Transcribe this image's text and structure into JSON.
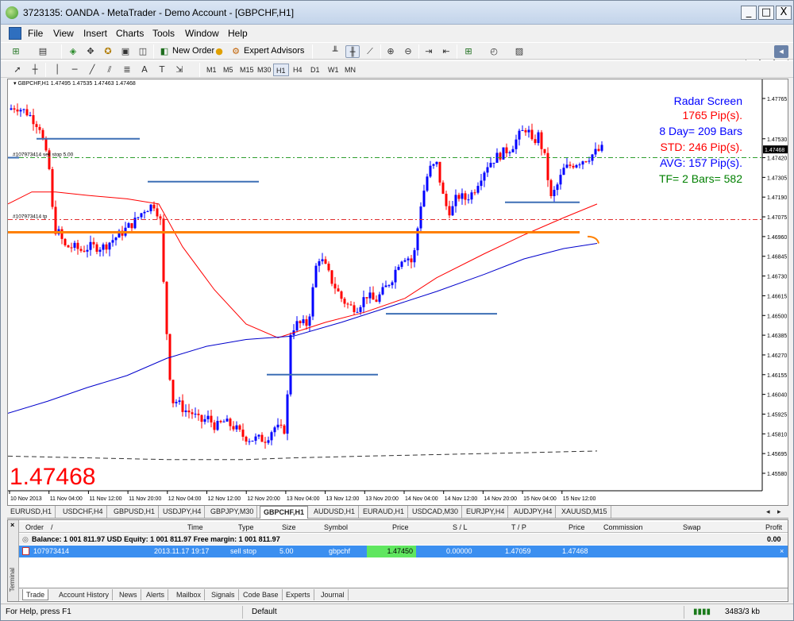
{
  "window": {
    "title": "3723135: OANDA - MetaTrader - Demo Account - [GBPCHF,H1]",
    "controls": [
      "_",
      "□",
      "X"
    ],
    "mdi_controls": [
      "_",
      "ᴩ",
      "X"
    ]
  },
  "menu": [
    "File",
    "View",
    "Insert",
    "Charts",
    "Tools",
    "Window",
    "Help"
  ],
  "toolbar": {
    "new_order": "New Order",
    "expert_advisors": "Expert Advisors",
    "timeframes": [
      "M1",
      "M5",
      "M15",
      "M30",
      "H1",
      "H4",
      "D1",
      "W1",
      "MN"
    ],
    "active_timeframe": "H1"
  },
  "chart": {
    "symbol_info": "GBPCHF,H1  1.47495 1.47535 1.47463 1.47468",
    "big_price": "1.47468",
    "order_label_1": "#107973414 sell stop 5.00",
    "order_label_2": "#107973414 tp",
    "current_price_tag": "1.47468",
    "radar": {
      "title": "Radar Screen",
      "pips": "1765 Pip(s).",
      "days": "8 Day= 209 Bars",
      "std": "STD: 246 Pip(s).",
      "avg": "AVG: 157 Pip(s).",
      "tf": "TF= 2 Bars= 582"
    },
    "colors": {
      "bull": "#0000ff",
      "bear": "#ff0000",
      "ma_fast": "#ff0000",
      "ma_slow": "#0000cc",
      "level": "#ff8000",
      "hlines": "#3d6fb5",
      "radar_title": "#0000ff",
      "radar_red": "#ff0000",
      "radar_green": "#008000"
    }
  },
  "chart_data": {
    "type": "candlestick",
    "y_ticks": [
      "1.47765",
      "1.47530",
      "1.47420",
      "1.47305",
      "1.47190",
      "1.47075",
      "1.46960",
      "1.46845",
      "1.46730",
      "1.46615",
      "1.46500",
      "1.46385",
      "1.46270",
      "1.46155",
      "1.46040",
      "1.45925",
      "1.45810",
      "1.45695",
      "1.45580"
    ],
    "x_ticks": [
      "10 Nov 2013",
      "11 Nov 04:00",
      "11 Nov 12:00",
      "11 Nov 20:00",
      "12 Nov 04:00",
      "12 Nov 12:00",
      "12 Nov 20:00",
      "13 Nov 04:00",
      "13 Nov 12:00",
      "13 Nov 20:00",
      "14 Nov 04:00",
      "14 Nov 12:00",
      "14 Nov 20:00",
      "15 Nov 04:00",
      "15 Nov 12:00"
    ],
    "ylim": [
      1.4556,
      1.4785
    ]
  },
  "symbol_tabs": [
    "EURUSD,H1",
    "USDCHF,H4",
    "GBPUSD,H1",
    "USDJPY,H4",
    "GBPJPY,M30",
    "GBPCHF,H1",
    "AUDUSD,H1",
    "EURAUD,H1",
    "USDCAD,M30",
    "EURJPY,H4",
    "AUDJPY,H4",
    "XAUUSD,M15"
  ],
  "active_symbol_tab": "GBPCHF,H1",
  "terminal": {
    "side_label": "Terminal",
    "columns": [
      "Order",
      "Time",
      "Type",
      "Size",
      "Symbol",
      "Price",
      "S / L",
      "T / P",
      "Price",
      "Commission",
      "Swap",
      "Profit"
    ],
    "balance_text": "Balance: 1 001 811.97 USD  Equity: 1 001 811.97  Free margin: 1 001 811.97",
    "balance_profit": "0.00",
    "row": {
      "order": "107973414",
      "time": "2013.11.17 19:17",
      "type": "sell stop",
      "size": "5.00",
      "symbol": "gbpchf",
      "price": "1.47450",
      "sl": "0.00000",
      "tp": "1.47059",
      "cur_price": "1.47468"
    },
    "tabs": [
      "Trade",
      "Account History",
      "News",
      "Alerts",
      "Mailbox",
      "Signals",
      "Code Base",
      "Experts",
      "Journal"
    ],
    "active_tab": "Trade"
  },
  "status": {
    "help": "For Help, press F1",
    "profile": "Default",
    "traffic": "3483/3 kb"
  }
}
